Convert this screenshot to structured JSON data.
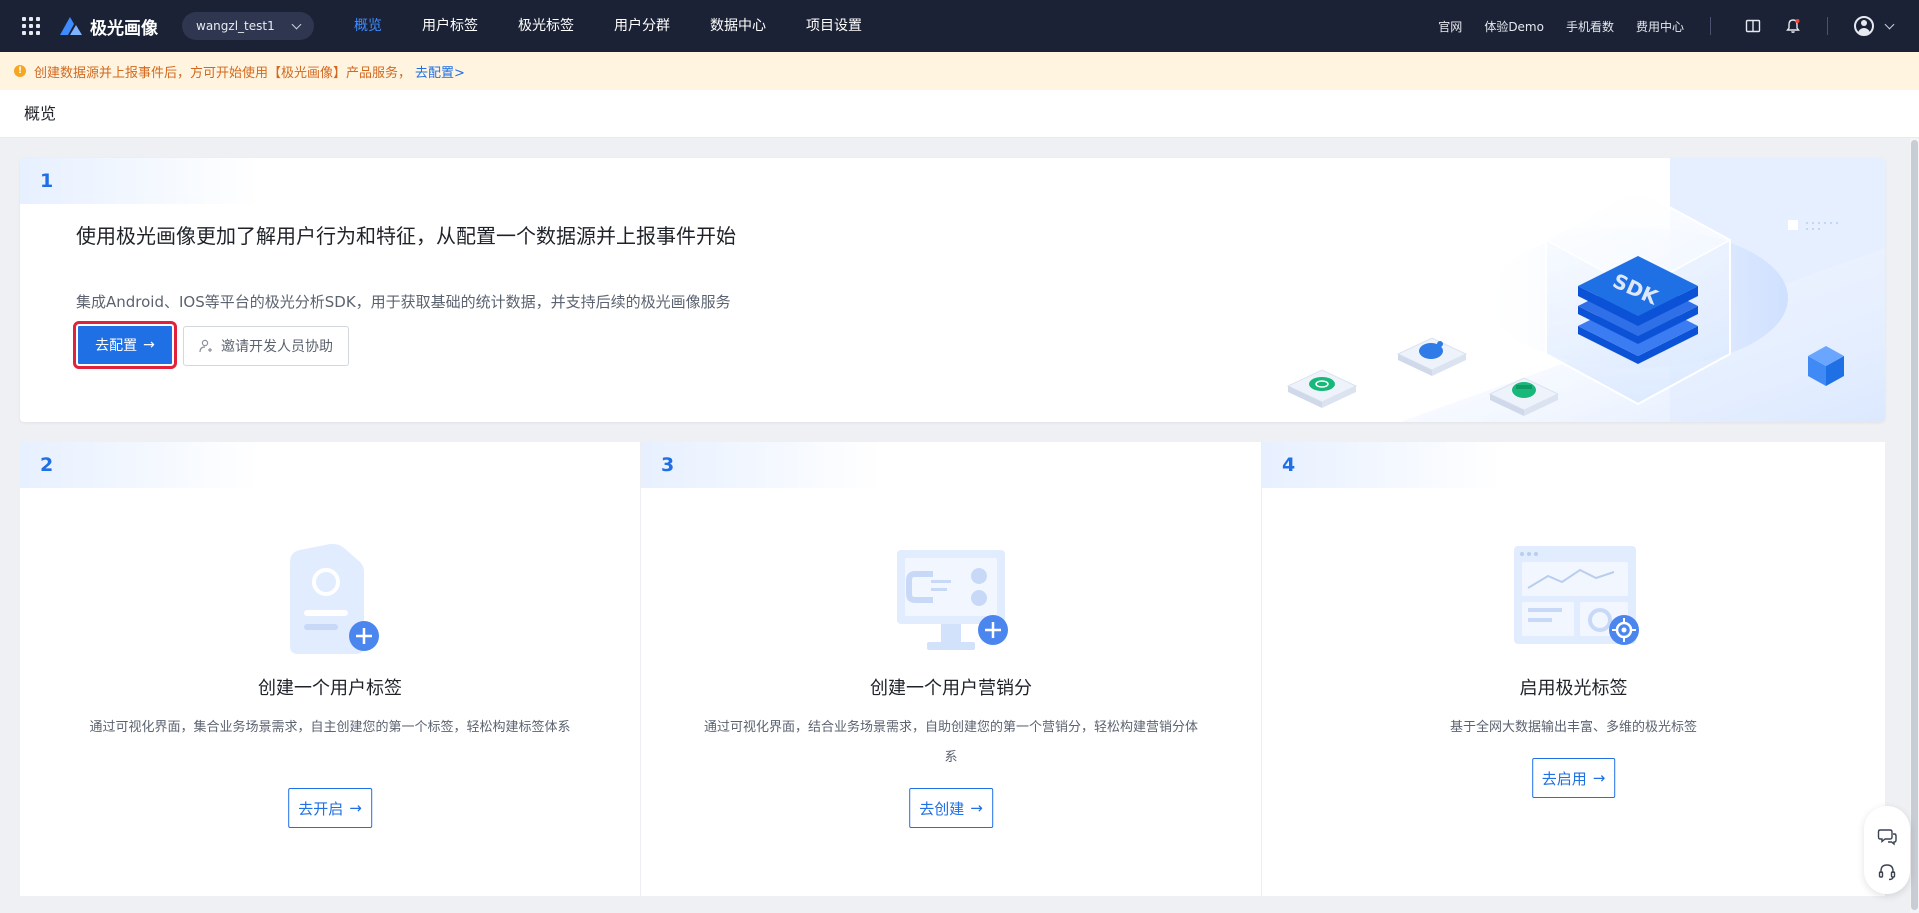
{
  "topbar": {
    "brand": "极光画像",
    "project": "wangzl_test1",
    "nav": [
      {
        "label": "概览",
        "active": true
      },
      {
        "label": "用户标签",
        "active": false
      },
      {
        "label": "极光标签",
        "active": false
      },
      {
        "label": "用户分群",
        "active": false
      },
      {
        "label": "数据中心",
        "active": false
      },
      {
        "label": "项目设置",
        "active": false
      }
    ],
    "links": [
      "官网",
      "体验Demo",
      "手机看数",
      "费用中心"
    ],
    "icons": [
      "apps-grid-icon",
      "book-icon",
      "bell-icon",
      "user-avatar-icon",
      "chevron-down-icon"
    ]
  },
  "notice": {
    "icon": "warning-icon",
    "text": "创建数据源并上报事件后，方可开始使用【极光画像】产品服务，",
    "link": "去配置>"
  },
  "page": {
    "title": "概览"
  },
  "step1": {
    "num": "1",
    "title": "使用极光画像更加了解用户行为和特征，从配置一个数据源并上报事件开始",
    "desc": "集成Android、IOS等平台的极光分析SDK，用于获取基础的统计数据，并支持后续的极光画像服务",
    "primary": "去配置",
    "secondary": "邀请开发人员协助",
    "sdk_label": "SDK"
  },
  "cards": [
    {
      "num": "2",
      "title": "创建一个用户标签",
      "desc": "通过可视化界面，集合业务场景需求，自主创建您的第一个标签，轻松构建标签体系",
      "button": "去开启"
    },
    {
      "num": "3",
      "title": "创建一个用户营销分",
      "desc": "通过可视化界面，结合业务场景需求，自助创建您的第一个营销分，轻松构建营销分体系",
      "button": "去创建"
    },
    {
      "num": "4",
      "title": "启用极光标签",
      "desc": "基于全网大数据输出丰富、多维的极光标签",
      "button": "去启用"
    }
  ],
  "colors": {
    "primary": "#1f6fe5",
    "nav_bg": "#1b2235",
    "notice_bg": "#fff4e0",
    "notice_text": "#d2691e",
    "highlight": "#e0223a"
  }
}
